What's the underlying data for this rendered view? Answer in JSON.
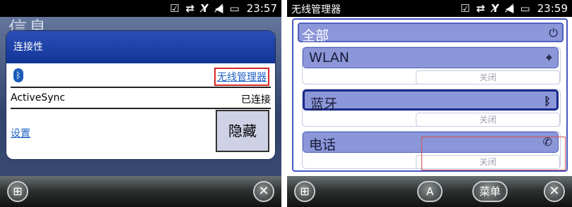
{
  "left": {
    "status": {
      "time": "23:57",
      "icons": [
        "checkbox-icon",
        "sync-arrows-icon",
        "no-signal-icon",
        "volume-mute-icon",
        "battery-icon"
      ]
    },
    "background_title": "信息",
    "dialog": {
      "header": "连接性",
      "wireless_manager_link": "无线管理器",
      "activesync_label": "ActiveSync",
      "activesync_status": "已连接",
      "settings_link": "设置",
      "hide_button": "隐藏"
    },
    "softkeys": {
      "close": "✕"
    }
  },
  "right": {
    "status": {
      "title": "无线管理器",
      "time": "23:59",
      "icons": [
        "checkbox-icon",
        "sync-arrows-icon",
        "no-signal-icon",
        "volume-mute-icon",
        "battery-icon"
      ]
    },
    "all_label": "全部",
    "items": [
      {
        "label": "WLAN",
        "status": "关闭",
        "icon": "wifi-off-icon",
        "selected": false
      },
      {
        "label": "蓝牙",
        "status": "关闭",
        "icon": "bluetooth-off-icon",
        "selected": true
      },
      {
        "label": "电话",
        "status": "关闭",
        "icon": "phone-off-icon",
        "selected": false
      }
    ],
    "softkeys": {
      "ime": "A",
      "menu": "菜单",
      "close": "✕"
    }
  }
}
